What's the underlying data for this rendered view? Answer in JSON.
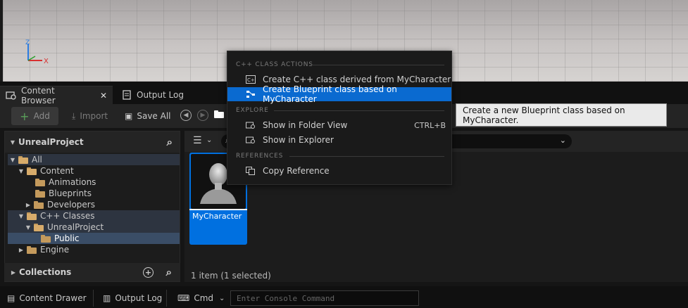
{
  "viewport": {
    "axis_z": "Z",
    "axis_x": "X"
  },
  "tabs": [
    {
      "label": "Content Browser",
      "close": "✕"
    },
    {
      "label": "Output Log"
    }
  ],
  "toolbar": {
    "add": "Add",
    "import": "Import",
    "save_all": "Save All"
  },
  "sidebar": {
    "title": "UnrealProject",
    "tree": [
      {
        "label": "All"
      },
      {
        "label": "Content"
      },
      {
        "label": "Animations"
      },
      {
        "label": "Blueprints"
      },
      {
        "label": "Developers"
      },
      {
        "label": "C++ Classes"
      },
      {
        "label": "UnrealProject"
      },
      {
        "label": "Public"
      },
      {
        "label": "Engine"
      }
    ],
    "collections": "Collections"
  },
  "content": {
    "asset_name": "MyCharacter",
    "item_count": "1 item (1 selected)"
  },
  "context_menu": {
    "section1": "C++ CLASS ACTIONS",
    "item1": "Create C++ class derived from MyCharacter",
    "item2": "Create Blueprint class based on MyCharacter",
    "section2": "EXPLORE",
    "item3": "Show in Folder View",
    "item3_shortcut": "CTRL+B",
    "item4": "Show in Explorer",
    "section3": "REFERENCES",
    "item5": "Copy Reference"
  },
  "tooltip": "Create a new Blueprint class based on MyCharacter.",
  "statusbar": {
    "content_drawer": "Content Drawer",
    "output_log": "Output Log",
    "cmd": "Cmd",
    "console_placeholder": "Enter Console Command"
  },
  "colors": {
    "accent": "#0070e0",
    "highlight": "#0a6ad0",
    "folder": "#c49a5c"
  }
}
